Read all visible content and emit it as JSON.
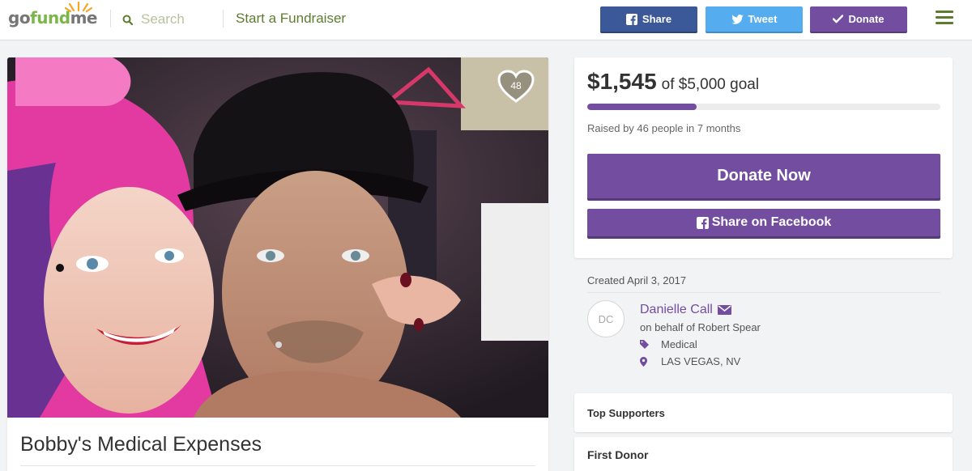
{
  "header": {
    "logo": {
      "go": "go",
      "fund": "fund",
      "me": "me"
    },
    "search_placeholder": "Search",
    "start_label": "Start a Fundraiser",
    "share_label": "Share",
    "tweet_label": "Tweet",
    "donate_label": "Donate"
  },
  "campaign": {
    "title": "Bobby's Medical Expenses",
    "hearts": "48",
    "raised": "$1,545",
    "goal_text": "of $5,000 goal",
    "progress": 0.309,
    "raised_by": "Raised by 46 people in 7 months",
    "donate_now": "Donate Now",
    "share_facebook": "Share on Facebook",
    "created": "Created April 3, 2017",
    "organizer_initials": "DC",
    "organizer_name": "Danielle Call",
    "behalf": "on behalf of Robert Spear",
    "category": "Medical",
    "location": "LAS VEGAS, NV"
  },
  "supporters": {
    "top_title": "Top Supporters",
    "first_title": "First Donor"
  },
  "colors": {
    "brand_green": "#7bb648",
    "purple": "#734da0",
    "facebook": "#3b5998",
    "twitter": "#55acee"
  }
}
